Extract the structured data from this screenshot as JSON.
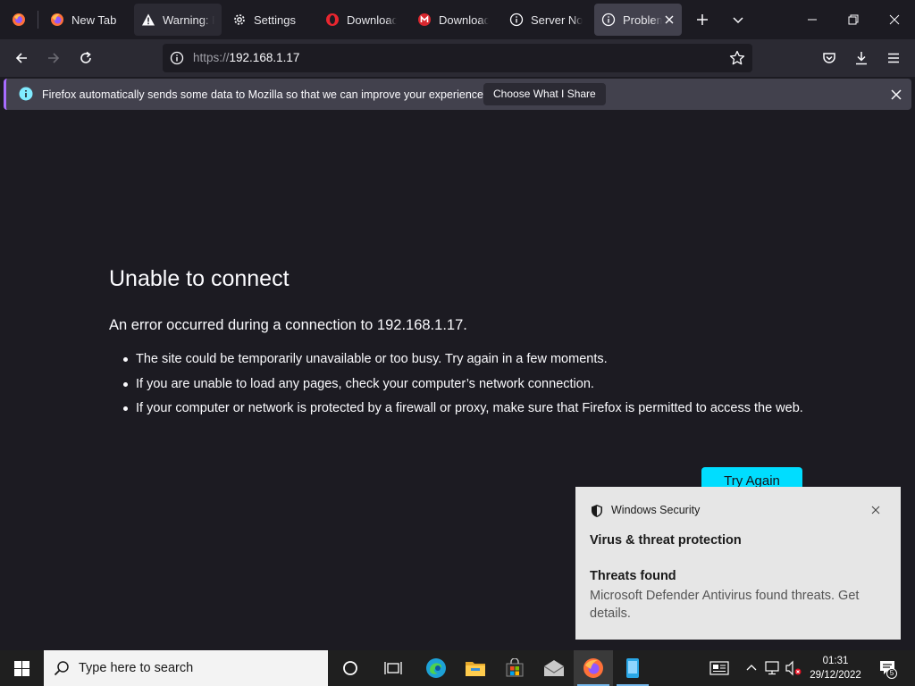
{
  "browser": {
    "tabs": [
      {
        "label": "",
        "icon": "firefox-view-icon"
      },
      {
        "label": "New Tab",
        "icon": "firefox-icon"
      },
      {
        "label": "Warning: P",
        "icon": "warning-icon"
      },
      {
        "label": "Settings",
        "icon": "gear-icon"
      },
      {
        "label": "Download",
        "icon": "opera-icon"
      },
      {
        "label": "Download",
        "icon": "mega-icon"
      },
      {
        "label": "Server Not",
        "icon": "info-icon"
      },
      {
        "label": "Problem",
        "icon": "info-icon"
      }
    ],
    "url_scheme": "https://",
    "url_host": "192.168.1.17"
  },
  "notification": {
    "text": "Firefox automatically sends some data to Mozilla so that we can improve your experience.",
    "button": "Choose What I Share"
  },
  "error_page": {
    "title": "Unable to connect",
    "description": "An error occurred during a connection to 192.168.1.17.",
    "items": [
      "The site could be temporarily unavailable or too busy. Try again in a few moments.",
      "If you are unable to load any pages, check your computer’s network connection.",
      "If your computer or network is protected by a firewall or proxy, make sure that Firefox is permitted to access the web."
    ],
    "button": "Try Again"
  },
  "toast": {
    "app": "Windows Security",
    "title": "Virus & threat protection",
    "subtitle": "Threats found",
    "body": "Microsoft Defender Antivirus found threats. Get details."
  },
  "taskbar": {
    "search_placeholder": "Type here to search",
    "time": "01:31",
    "date": "29/12/2022",
    "notification_count": "5"
  },
  "colors": {
    "accent": "#00ddff",
    "background": "#1c1b22",
    "toolbar": "#2b2a33",
    "infobar": "#42414d"
  }
}
